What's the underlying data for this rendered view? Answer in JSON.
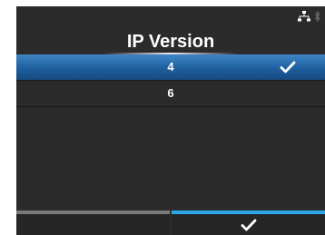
{
  "status_bar": {
    "icons": [
      "network-icon",
      "bluetooth-icon"
    ]
  },
  "header": {
    "title": "IP Version"
  },
  "options": [
    {
      "label": "4",
      "selected": true
    },
    {
      "label": "6",
      "selected": false
    }
  ],
  "softkeys": {
    "left": {
      "label": ""
    },
    "right": {
      "icon": "check-icon"
    }
  },
  "colors": {
    "selected_row": "#1e5f9e",
    "background": "#2b2b2b",
    "softkey_active": "#2aa7e6",
    "softkey_inactive": "#7a7a7a"
  }
}
